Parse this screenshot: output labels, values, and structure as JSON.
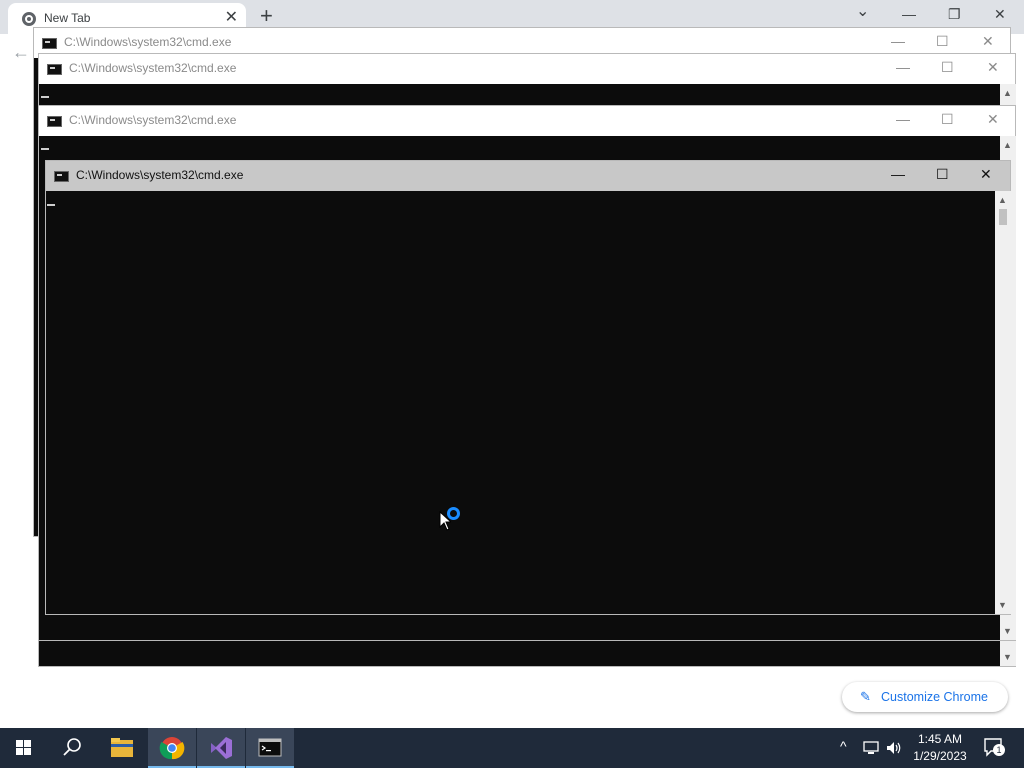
{
  "browser": {
    "tab_title": "New Tab",
    "tab_close": "✕",
    "new_tab": "+",
    "tab_search": "⌄",
    "minimize": "—",
    "restore": "❐",
    "close": "✕",
    "back": "←",
    "customize_label": "Customize Chrome",
    "customize_icon": "✎"
  },
  "cmd_windows": [
    {
      "title": "C:\\Windows\\system32\\cmd.exe",
      "min": "—",
      "max": "☐",
      "close": "✕"
    },
    {
      "title": "C:\\Windows\\system32\\cmd.exe",
      "min": "—",
      "max": "☐",
      "close": "✕"
    },
    {
      "title": "C:\\Windows\\system32\\cmd.exe",
      "min": "—",
      "max": "☐",
      "close": "✕"
    },
    {
      "title": "C:\\Windows\\system32\\cmd.exe",
      "min": "—",
      "max": "☐",
      "close": "✕"
    }
  ],
  "taskbar": {
    "time": "1:45 AM",
    "date": "1/29/2023",
    "notification_count": "1",
    "apps": [
      "start",
      "search",
      "file-explorer",
      "chrome",
      "visual-studio",
      "cmd"
    ]
  },
  "colors": {
    "console_bg": "#0c0c0c",
    "taskbar_bg": "#1f2a3a",
    "accent_blue": "#1a73e8"
  }
}
